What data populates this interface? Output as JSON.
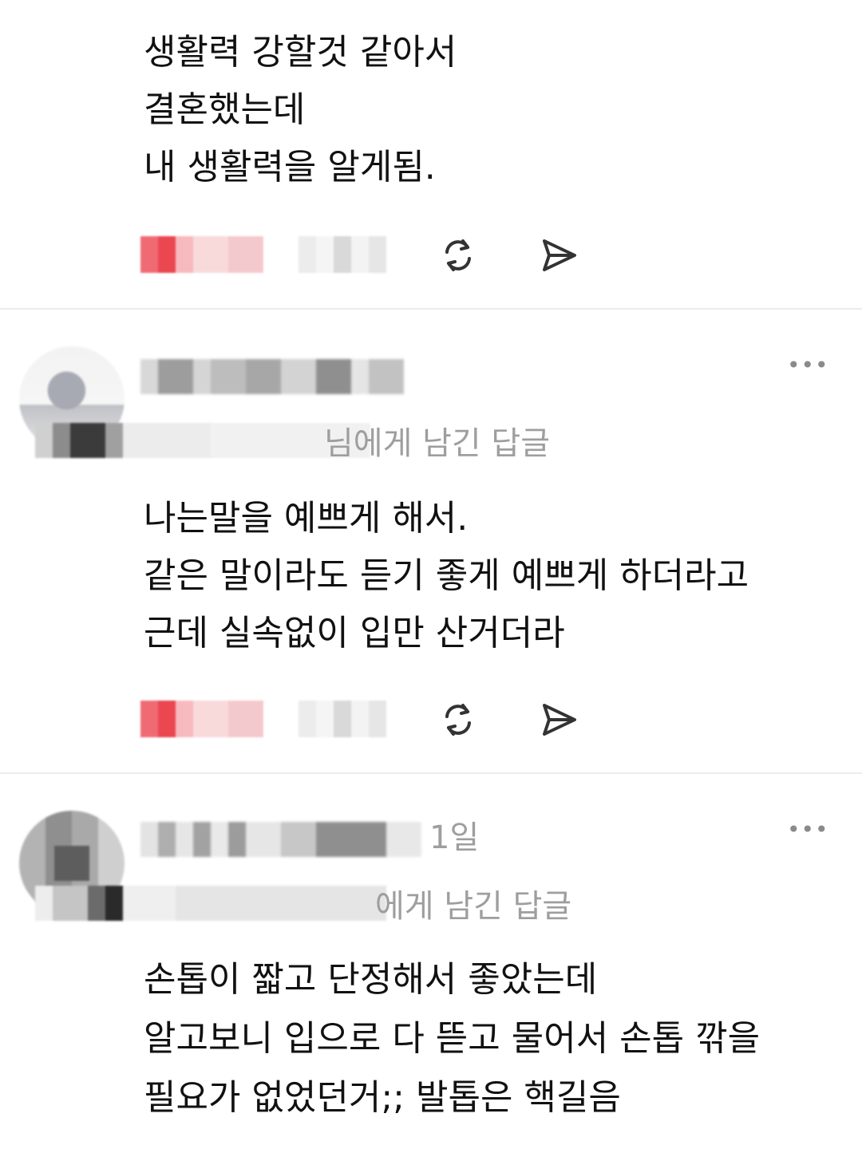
{
  "posts": [
    {
      "lines": [
        "생활력 강할것 같아서",
        "결혼했는데",
        "내 생활력을 알게됨."
      ]
    },
    {
      "reply_label": "님에게 남긴 답글",
      "lines": [
        "나는말을 예쁘게 해서.",
        "같은 말이라도 듣기 좋게 예쁘게 하더라고",
        "근데 실속없이 입만 산거더라"
      ]
    },
    {
      "time": "1일",
      "reply_label": "에게 남긴 답글",
      "lines": [
        "손톱이 짧고 단정해서 좋았는데",
        "알고보니 입으로 다 뜯고 물어서 손톱 깎을",
        "필요가 없었던거;; 발톱은 핵길음"
      ]
    }
  ],
  "icons": {
    "repost": "repost-icon",
    "share": "send-icon",
    "more": "more-icon"
  },
  "ui": {
    "more_label": "•••"
  }
}
